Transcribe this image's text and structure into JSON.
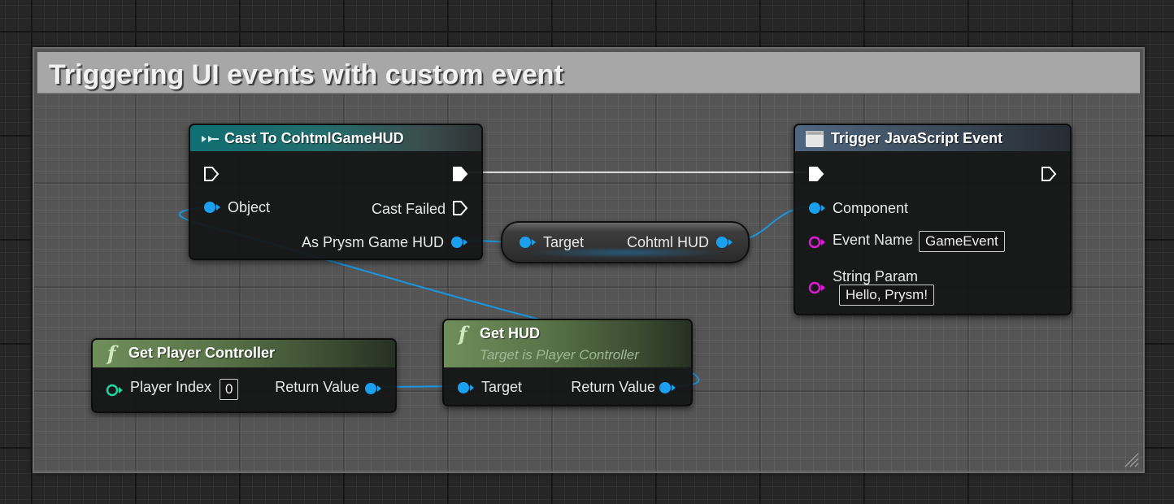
{
  "comment": {
    "title": "Triggering UI events with custom event"
  },
  "colors": {
    "object_pin": "#1aa0ee",
    "string_pin": "#e01ad6",
    "int_pin": "#1fd7a0",
    "exec_pin": "#ffffff",
    "exec_wire": "#d9d9d9",
    "object_wire": "#1a96e0"
  },
  "nodes": {
    "cast": {
      "icon": "cast-arrow-icon",
      "title": "Cast To CohtmlGameHUD",
      "pins": {
        "object": "Object",
        "cast_failed": "Cast Failed",
        "as_hud": "As Prysm Game HUD"
      }
    },
    "cohtml_hud": {
      "target": "Target",
      "output": "Cohtml HUD"
    },
    "trigger": {
      "icon": "function-box-icon",
      "title": "Trigger JavaScript Event",
      "pins": {
        "component": "Component",
        "event_name": "Event Name",
        "event_name_value": "GameEvent",
        "string_param": "String Param",
        "string_param_value": "Hello, Prysm!"
      }
    },
    "get_hud": {
      "icon": "function-f-icon",
      "title": "Get HUD",
      "subtitle": "Target is Player Controller",
      "pins": {
        "target": "Target",
        "return_value": "Return Value"
      }
    },
    "get_player_controller": {
      "icon": "function-f-icon",
      "title": "Get Player Controller",
      "pins": {
        "player_index": "Player Index",
        "player_index_value": "0",
        "return_value": "Return Value"
      }
    }
  }
}
